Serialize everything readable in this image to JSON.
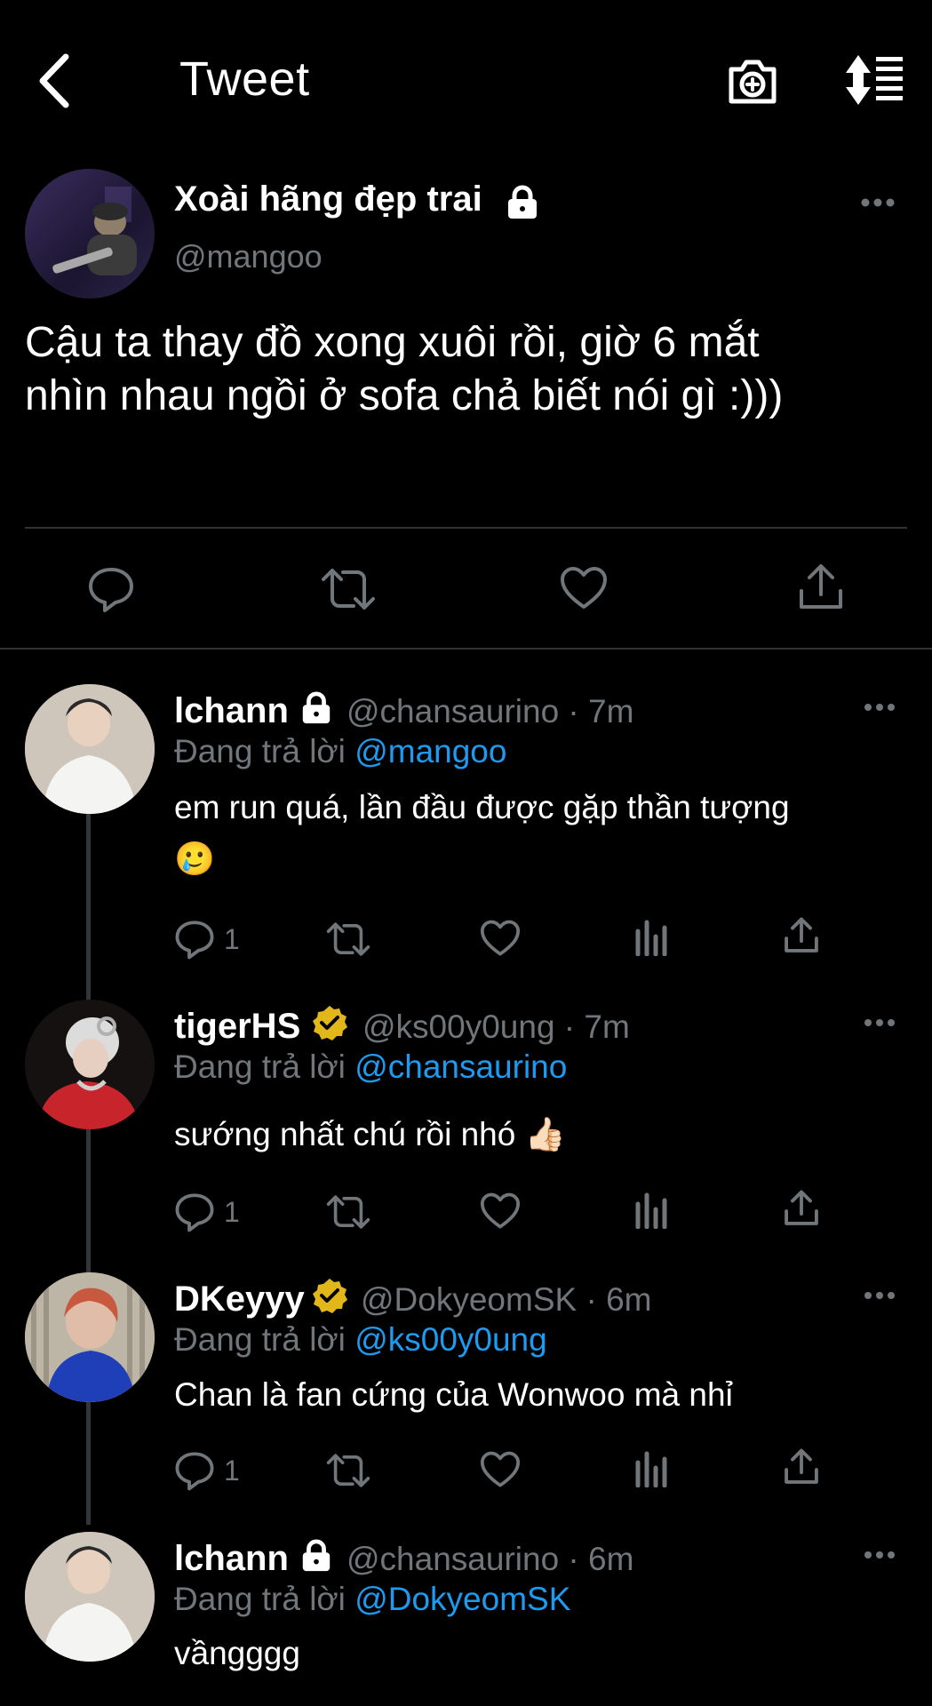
{
  "header": {
    "title": "Tweet"
  },
  "main_tweet": {
    "display_name": "Xoài hãng đẹp trai",
    "handle": "@mangoo",
    "text_line1": "Cậu ta thay đồ xong xuôi rồi, giờ 6 mắt",
    "text_line2": "nhìn nhau ngồi ở sofa chả biết nói gì :)))"
  },
  "replies": [
    {
      "display_name": "lchann",
      "handle_time": "@chansaurino · 7m",
      "replying_prefix": "Đang trả lời",
      "replying_to": "@mangoo",
      "text_line1": "em run quá, lần đầu được gặp thần tượng",
      "emoji": "🥲",
      "reply_count": "1"
    },
    {
      "display_name": "tigerHS",
      "handle_time": "@ks00y0ung · 7m",
      "replying_prefix": "Đang trả lời",
      "replying_to": "@chansaurino",
      "text_line1": "sướng nhất chú rồi nhó 👍🏻",
      "reply_count": "1"
    },
    {
      "display_name": "DKeyyy",
      "handle_time": "@DokyeomSK · 6m",
      "replying_prefix": "Đang trả lời",
      "replying_to": "@ks00y0ung",
      "text_line1": "Chan là fan cứng của Wonwoo mà nhỉ",
      "reply_count": "1"
    },
    {
      "display_name": "lchann",
      "handle_time": "@chansaurino · 6m",
      "replying_prefix": "Đang trả lời",
      "replying_to": "@DokyeomSK",
      "text_line1": "vầngggg"
    }
  ],
  "colors": {
    "background": "#000000",
    "text": "#ffffff",
    "muted": "#71767b",
    "link": "#1d9bf0",
    "verified": "#e2b719"
  },
  "icons": {
    "back": "chevron-left-icon",
    "camera": "camera-plus-icon",
    "sort": "sort-lines-icon",
    "lock": "lock-icon",
    "verified": "verified-badge-icon",
    "reply": "reply-icon",
    "retweet": "retweet-icon",
    "like": "heart-icon",
    "analytics": "analytics-icon",
    "share": "share-icon",
    "more": "more-icon"
  }
}
